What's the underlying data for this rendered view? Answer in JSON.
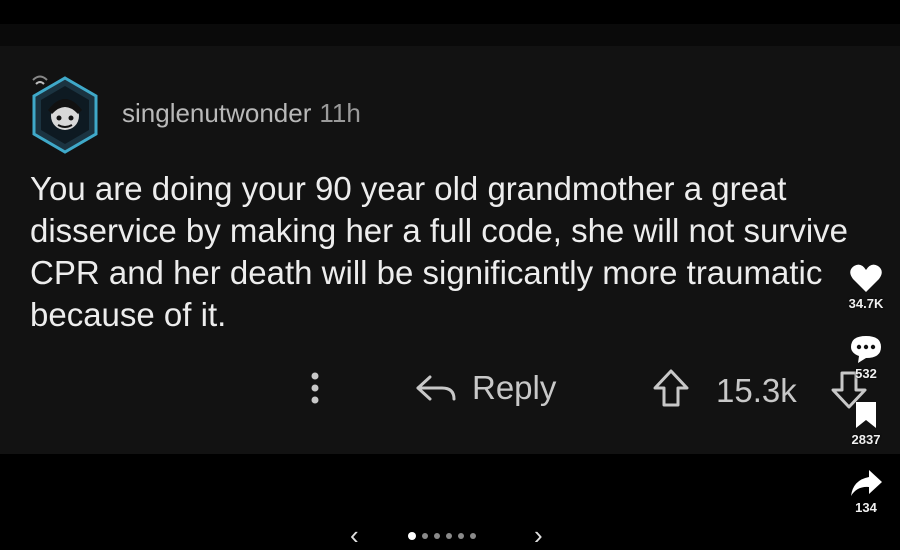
{
  "comment": {
    "username": "singlenutwonder",
    "time": "11h",
    "body": "You are doing your 90 year old grandmother a great disservice by making her a full code, she will not survive CPR and her death will be significantly more traumatic because of it.",
    "reply_label": "Reply",
    "score": "15.3k"
  },
  "side_actions": {
    "likes": "34.7K",
    "comments": "532",
    "saves": "2837",
    "shares": "134"
  },
  "pager": {
    "prev": "‹",
    "next": "›"
  },
  "icons": {
    "avatar": "hexagon-avatar-icon",
    "more": "vertical-ellipsis-icon",
    "reply": "reply-arrow-icon",
    "upvote": "upvote-arrow-icon",
    "downvote": "downvote-arrow-icon",
    "like": "heart-icon",
    "comment": "comment-bubble-icon",
    "save": "bookmark-icon",
    "share": "share-arrow-icon"
  },
  "colors": {
    "background": "#000000",
    "card": "#121212",
    "text": "#ededed",
    "muted": "#9a9a9a",
    "avatar_ring": "#3fa9c9"
  }
}
